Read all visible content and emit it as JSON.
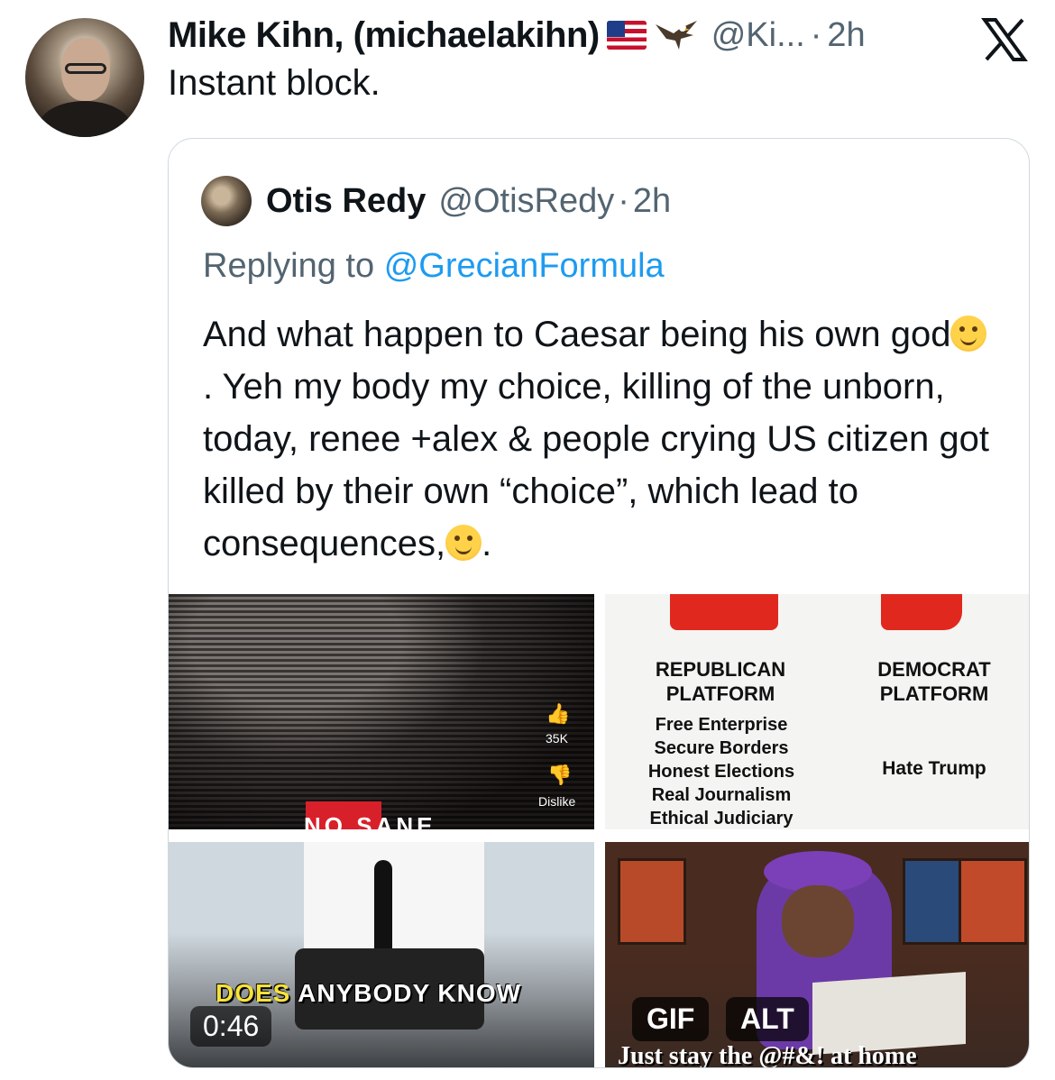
{
  "tweet": {
    "author_name": "Mike Kihn, (michaelakihn)",
    "handle": "@Ki...",
    "separator": "·",
    "time": "2h",
    "text": "Instant block."
  },
  "quoted": {
    "author_name": "Otis Redy",
    "handle": "@OtisRedy",
    "separator": "·",
    "time": "2h",
    "replying_prefix": "Replying to",
    "replying_mention": "@GrecianFormula",
    "body_part1": "And what happen to Caesar being his own god",
    "body_part2": ". Yeh my body my choice, killing of the unborn, today, renee +alex & people crying US citizen got killed by their own “choice”, which lead to consequences,",
    "body_part3": "."
  },
  "media": {
    "tile1": {
      "like_count": "35K",
      "dislike_label": "Dislike",
      "overlay_text": "NO SANE"
    },
    "tile2": {
      "rep_title": "REPUBLICAN PLATFORM",
      "dem_title": "DEMOCRAT PLATFORM",
      "rep_items": [
        "Free Enterprise",
        "Secure Borders",
        "Honest Elections",
        "Real Journalism",
        "Ethical Judiciary"
      ],
      "dem_items": [
        "Hate Trump"
      ]
    },
    "tile3": {
      "caption_highlight": "DOES",
      "caption_rest": " ANYBODY KNOW",
      "duration": "0:46"
    },
    "tile4": {
      "gif_label": "GIF",
      "alt_label": "ALT",
      "bottom_text": "Just stay the @#&! at home"
    }
  },
  "icons": {
    "flag": "us-flag-icon",
    "eagle": "eagle-icon",
    "logo": "x-logo-icon",
    "emoji1": "thinking-face-emoji",
    "emoji2": "winking-face-emoji"
  },
  "colors": {
    "link": "#1d9bf0",
    "secondary_text": "#536471",
    "border": "#cfd9de"
  }
}
